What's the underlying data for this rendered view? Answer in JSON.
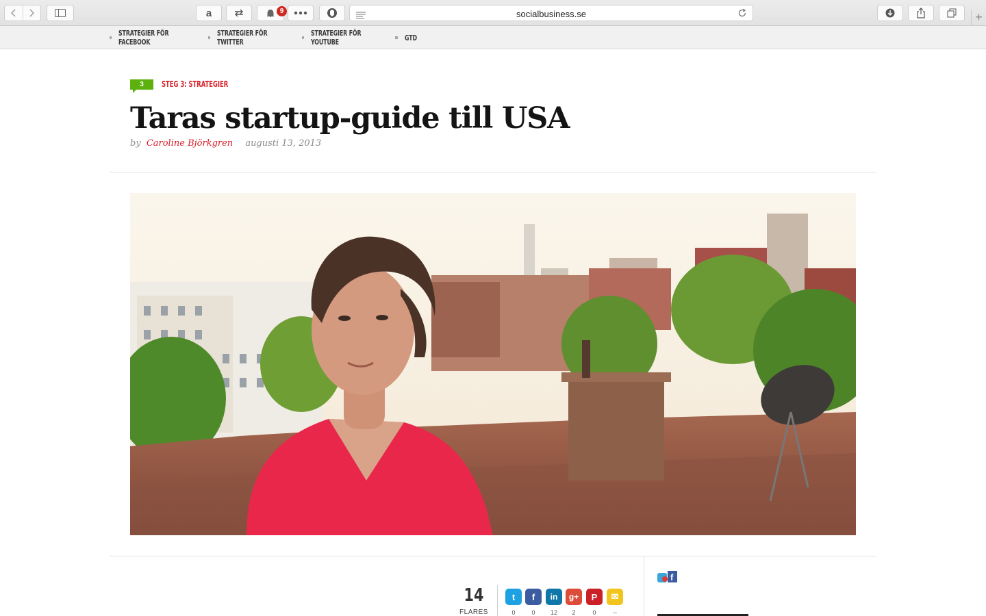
{
  "browser": {
    "url": "socialbusiness.se",
    "extension_badge_count": "9",
    "icons": [
      "back-icon",
      "forward-icon",
      "sidebar-icon",
      "amazon-icon",
      "swap-icon",
      "ghostery-icon",
      "more-icon",
      "shield-icon",
      "reader-icon",
      "reload-icon",
      "download-icon",
      "share-icon",
      "tabs-icon",
      "new-tab-icon"
    ]
  },
  "site_nav": {
    "items": [
      {
        "label": "STRATEGIER FÖR FACEBOOK"
      },
      {
        "label": "STRATEGIER FÖR TWITTER"
      },
      {
        "label": "STRATEGIER FÖR YOUTUBE"
      },
      {
        "label": "GTD"
      }
    ]
  },
  "article": {
    "category_number": "3",
    "category": "STEG 3: STRATEGIER",
    "title": "Taras startup-guide till USA",
    "by": "by",
    "author": "Caroline Björkgren",
    "date": "augusti 13, 2013"
  },
  "share": {
    "flares_count": "14",
    "flares_label": "FLARES",
    "buttons": [
      {
        "network": "twitter",
        "glyph": "t",
        "color": "#1da1e2",
        "count": "0"
      },
      {
        "network": "facebook",
        "glyph": "f",
        "color": "#3b5ca0",
        "count": "0"
      },
      {
        "network": "linkedin",
        "glyph": "in",
        "color": "#0e76a8",
        "count": "12"
      },
      {
        "network": "google-plus",
        "glyph": "g+",
        "color": "#dd4b39",
        "count": "2"
      },
      {
        "network": "pinterest",
        "glyph": "P",
        "color": "#cb2027",
        "count": "0"
      },
      {
        "network": "email",
        "glyph": "✉",
        "color": "#f2c41e",
        "count": "--"
      }
    ]
  },
  "colors": {
    "accent_red": "#d8202a",
    "category_green": "#5cb10f"
  }
}
